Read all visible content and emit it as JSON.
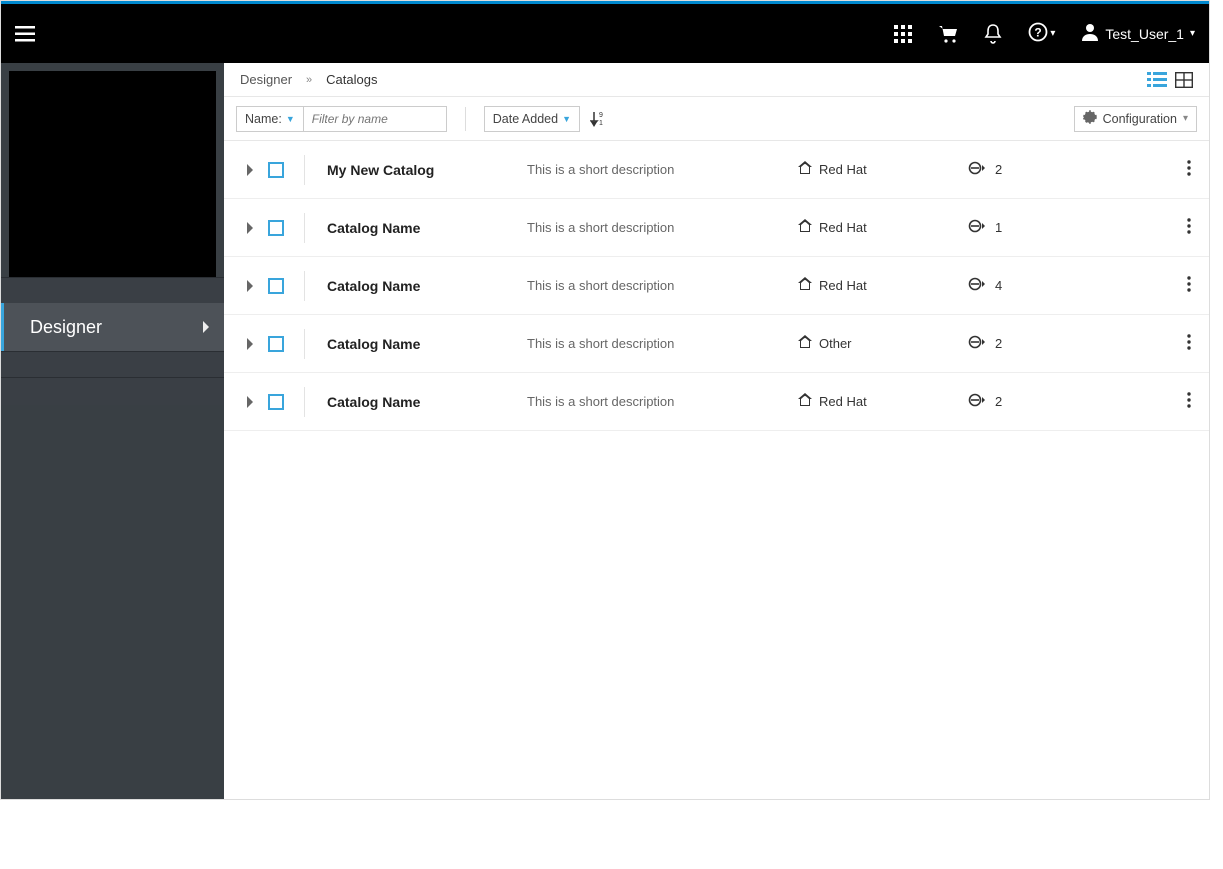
{
  "topbar": {
    "user_name": "Test_User_1"
  },
  "sidebar": {
    "active_item": "Designer"
  },
  "breadcrumb": {
    "root": "Designer",
    "current": "Catalogs"
  },
  "toolbar": {
    "filter_type_label": "Name:",
    "filter_placeholder": "Filter by name",
    "sort_label": "Date Added",
    "config_label": "Configuration"
  },
  "rows": [
    {
      "title": "My New Catalog",
      "desc": "This is a short description",
      "org": "Red Hat",
      "count": "2"
    },
    {
      "title": "Catalog Name",
      "desc": "This is a short description",
      "org": "Red Hat",
      "count": "1"
    },
    {
      "title": "Catalog Name",
      "desc": "This is a short description",
      "org": "Red Hat",
      "count": "4"
    },
    {
      "title": "Catalog Name",
      "desc": "This is a short description",
      "org": "Other",
      "count": "2"
    },
    {
      "title": "Catalog Name",
      "desc": "This is a short description",
      "org": "Red Hat",
      "count": "2"
    }
  ]
}
